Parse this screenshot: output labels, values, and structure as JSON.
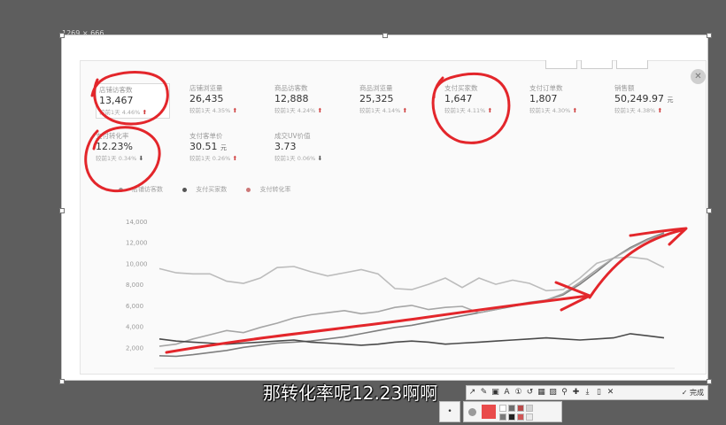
{
  "capture": {
    "dimension_label": "1269 × 666"
  },
  "metrics": [
    {
      "label": "店铺访客数",
      "value": "13,467",
      "unit": "",
      "change": "较前1天 4.46%",
      "dir": "up"
    },
    {
      "label": "店铺浏览量",
      "value": "26,435",
      "unit": "",
      "change": "较前1天 4.35%",
      "dir": "up"
    },
    {
      "label": "商品访客数",
      "value": "12,888",
      "unit": "",
      "change": "较前1天 4.24%",
      "dir": "up"
    },
    {
      "label": "商品浏览量",
      "value": "25,325",
      "unit": "",
      "change": "较前1天 4.14%",
      "dir": "up"
    },
    {
      "label": "支付买家数",
      "value": "1,647",
      "unit": "",
      "change": "较前1天 4.11%",
      "dir": "up"
    },
    {
      "label": "支付订单数",
      "value": "1,807",
      "unit": "",
      "change": "较前1天 4.30%",
      "dir": "up"
    },
    {
      "label": "销售额",
      "value": "50,249.97",
      "unit": "元",
      "change": "较前1天 4.38%",
      "dir": "up"
    },
    {
      "label": "支付转化率",
      "value": "12.23%",
      "unit": "",
      "change": "较前1天 0.34%",
      "dir": "down"
    },
    {
      "label": "支付客单价",
      "value": "30.51",
      "unit": "元",
      "change": "较前1天 0.26%",
      "dir": "up"
    },
    {
      "label": "成交UV价值",
      "value": "3.73",
      "unit": "",
      "change": "较前1天 0.06%",
      "dir": "down"
    }
  ],
  "legend": [
    "店铺访客数",
    "支付买家数",
    "支付转化率"
  ],
  "colors": {
    "annotation": "#e3262b",
    "line_main": "#7f7f7f",
    "line_light": "#b9b9b9",
    "line_dark": "#4a4a4a"
  },
  "chart_data": {
    "type": "line",
    "y_ticks": [
      "14,000",
      "12,000",
      "10,000",
      "8,000",
      "6,000",
      "4,000",
      "2,000"
    ],
    "ylim": [
      0,
      14000
    ],
    "grid": false,
    "series": [
      {
        "name": "店铺访客数",
        "color": "#7f7f7f",
        "values": [
          1200,
          1150,
          1300,
          1500,
          1700,
          2000,
          2200,
          2400,
          2500,
          2600,
          2800,
          3000,
          3300,
          3600,
          3900,
          4100,
          4400,
          4700,
          5000,
          5300,
          5600,
          5900,
          6200,
          6500,
          7000,
          8000,
          9200,
          10500,
          11500,
          12300,
          12900
        ]
      },
      {
        "name": "",
        "color": "#bcbcbc",
        "values": [
          9500,
          9100,
          9000,
          9000,
          8300,
          8100,
          8600,
          9600,
          9700,
          9200,
          8800,
          9100,
          9400,
          9000,
          7600,
          7500,
          8000,
          8600,
          7700,
          8600,
          8000,
          8400,
          8100,
          7400,
          7500,
          8600,
          10000,
          10500,
          10600,
          10400,
          9600
        ]
      },
      {
        "name": "",
        "color": "#a6a6a6",
        "values": [
          2100,
          2300,
          2800,
          3200,
          3600,
          3400,
          3900,
          4300,
          4800,
          5100,
          5300,
          5500,
          5200,
          5400,
          5800,
          6000,
          5600,
          5800,
          5900,
          5300,
          5600,
          6000,
          6300,
          6500,
          7100,
          8200,
          9400,
          10500,
          11400,
          12200,
          12800
        ]
      },
      {
        "name": "支付买家数",
        "color": "#4a4a4a",
        "values": [
          2800,
          2600,
          2500,
          2400,
          2300,
          2400,
          2500,
          2600,
          2700,
          2500,
          2400,
          2300,
          2200,
          2300,
          2500,
          2600,
          2500,
          2300,
          2400,
          2500,
          2600,
          2700,
          2800,
          2900,
          2800,
          2700,
          2800,
          2900,
          3300,
          3100,
          2900
        ]
      }
    ]
  },
  "subtitle": "那转化率呢12.23啊啊",
  "toolbar": {
    "icons": [
      "arrow-tool-icon",
      "pencil-tool-icon",
      "crop-tool-icon",
      "text-tool-icon",
      "number-marker-icon",
      "undo-icon",
      "mosaic-icon",
      "highlight-icon",
      "pin-icon",
      "save-icon",
      "download-icon",
      "bookmark-icon",
      "cancel-icon"
    ],
    "icon_glyphs": [
      "↗",
      "✎",
      "▣",
      "A",
      "①",
      "↺",
      "▦",
      "▨",
      "⚲",
      "✚",
      "⤓",
      "▯",
      "✕"
    ],
    "done_label": "完成"
  },
  "palette_colors": [
    "#ffffff",
    "#6f6f6f",
    "#b94b4b",
    "#d4d4d4",
    "#7a7a7a",
    "#222222",
    "#cf5757",
    "#e9e9e9"
  ]
}
